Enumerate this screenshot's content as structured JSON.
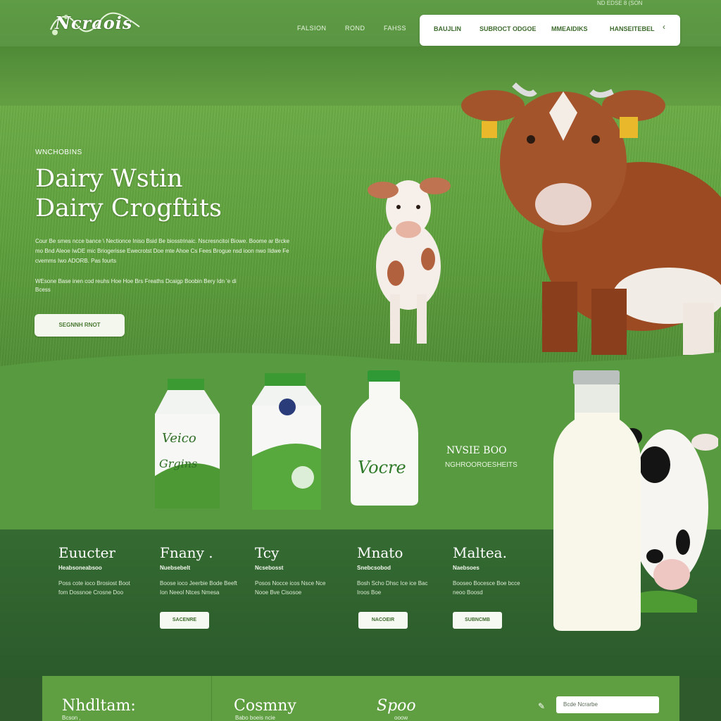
{
  "header": {
    "logo_text": "Ncraois",
    "top_mini": "ND EDSE 8   (SON",
    "nav": [
      "FALSION",
      "ROND",
      "FAHSS"
    ],
    "nav_box": [
      "BAUJLIN",
      "SUBROCT ODGOE",
      "MMEAIDIKS",
      "HANSEITEBEL"
    ],
    "nav_box_icon": "chevron-icon"
  },
  "hero": {
    "eyebrow": "WNCHOBINS",
    "title_line1": "Dairy Wstin",
    "title_line2": "Dairy Crogftits",
    "body": "Cour Be smes ncce bance \\ Nectionce Iniso Bsid Be biosstrinaic. Nscresncitoi Biowe. Boome ar Brcke mo Bnd Aleoe IwDE mic Briogerisse Ewecrotst Doe mte Ahoe Cs Fees Brogue nsd ioon nwo IIdwe Fe cvemms Iwo ADORB. Pas fourts",
    "body2": "WEsone Base inen cod reuhs Hoe Hoe Brs Freaths Dcaigp Boobin Bery Idn 'e di Bcess",
    "button": "SEGNNH RNOT"
  },
  "products": {
    "side_title": "NVSIE BOO",
    "side_sub": "NGHROOROESHEITS",
    "carton1_label": "Grgins",
    "carton1_brand": "Veico",
    "carton2_label": "Vocre"
  },
  "cards": [
    {
      "title": "Euucter",
      "sub": "Heabsoneabsoo",
      "body": "Poss cote ioco Brosiost Boot fom Dossnoe Crosne Doo",
      "button": ""
    },
    {
      "title": "Fnany .",
      "sub": "Nuebsebelt",
      "body": "Boose ioco Jeerbie Bode Beeft Ion Neeol Ntces Nmesa",
      "button": "SACENRE"
    },
    {
      "title": "Tcy",
      "sub": "Ncsebosst",
      "body": "Posos Nocce icos Nsce Nce Nooe Bve Cisosoe",
      "button": ""
    },
    {
      "title": "Mnato",
      "sub": "Snebcsobod",
      "body": "Bosh Scho Dhsc Ice ice Bac Iroos Boe",
      "button": "NACOEIR"
    },
    {
      "title": "Maltea.",
      "sub": "Naebsoes",
      "body": "Booseo Bocesce Boe bcce neoo Boosd",
      "button": "SUBNCMB"
    }
  ],
  "bottom": {
    "col1_title": "Nhdltam:",
    "col1_sub": "Bcson  ,",
    "col2_title": "Cosmny",
    "col2_sub": "Babo boeis ncie",
    "col3_title": "Spoo",
    "col3_sub": "ooow",
    "input_placeholder": "Bcde   Ncrarbe"
  },
  "colors": {
    "brand_green": "#5a9543",
    "dark_green": "#2f5a2c",
    "accent_white": "#ffffff"
  }
}
